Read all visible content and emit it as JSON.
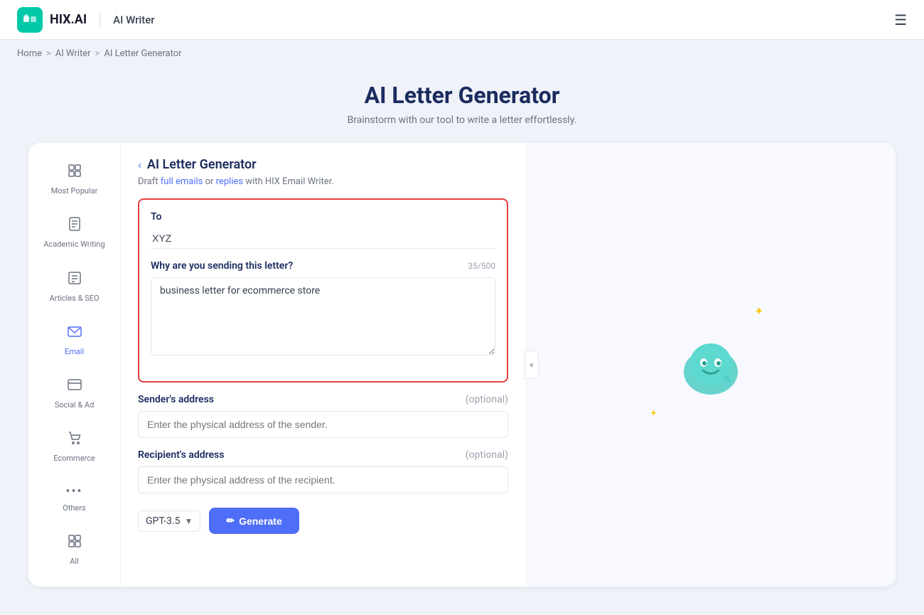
{
  "header": {
    "logo_text": "HIX.AI",
    "section_label": "AI Writer",
    "hamburger_aria": "menu"
  },
  "breadcrumb": {
    "home": "Home",
    "ai_writer": "AI Writer",
    "current": "AI Letter Generator"
  },
  "page": {
    "title": "AI Letter Generator",
    "subtitle": "Brainstorm with our tool to write a letter effortlessly."
  },
  "sidebar": {
    "items": [
      {
        "id": "most-popular",
        "label": "Most Popular",
        "icon": "⊞"
      },
      {
        "id": "academic-writing",
        "label": "Academic Writing",
        "icon": "📄"
      },
      {
        "id": "articles-seo",
        "label": "Articles & SEO",
        "icon": "🗂"
      },
      {
        "id": "email",
        "label": "Email",
        "icon": "✉"
      },
      {
        "id": "social-ad",
        "label": "Social & Ad",
        "icon": "🖥"
      },
      {
        "id": "ecommerce",
        "label": "Ecommerce",
        "icon": "🛒"
      },
      {
        "id": "others",
        "label": "Others",
        "icon": "···"
      },
      {
        "id": "all",
        "label": "All",
        "icon": "⊞"
      }
    ]
  },
  "form": {
    "back_label": "‹",
    "title": "AI Letter Generator",
    "description_prefix": "Draft ",
    "description_link1": "full emails",
    "description_middle": " or ",
    "description_link2": "replies",
    "description_suffix": " with HIX Email Writer.",
    "to_label": "To",
    "to_value": "XYZ",
    "to_placeholder": "",
    "why_label": "Why are you sending this letter?",
    "why_char_count": "35/500",
    "why_value": "business letter for ecommerce store",
    "why_placeholder": "",
    "sender_label": "Sender's address",
    "sender_optional": "(optional)",
    "sender_placeholder": "Enter the physical address of the sender.",
    "recipient_label": "Recipient's address",
    "recipient_optional": "(optional)",
    "recipient_placeholder": "Enter the physical address of the recipient.",
    "model_label": "GPT-3.5",
    "generate_label": "Generate",
    "generate_icon": "✏"
  },
  "collapse_btn": "«",
  "mascot": {
    "color": "#4ecdc4"
  }
}
